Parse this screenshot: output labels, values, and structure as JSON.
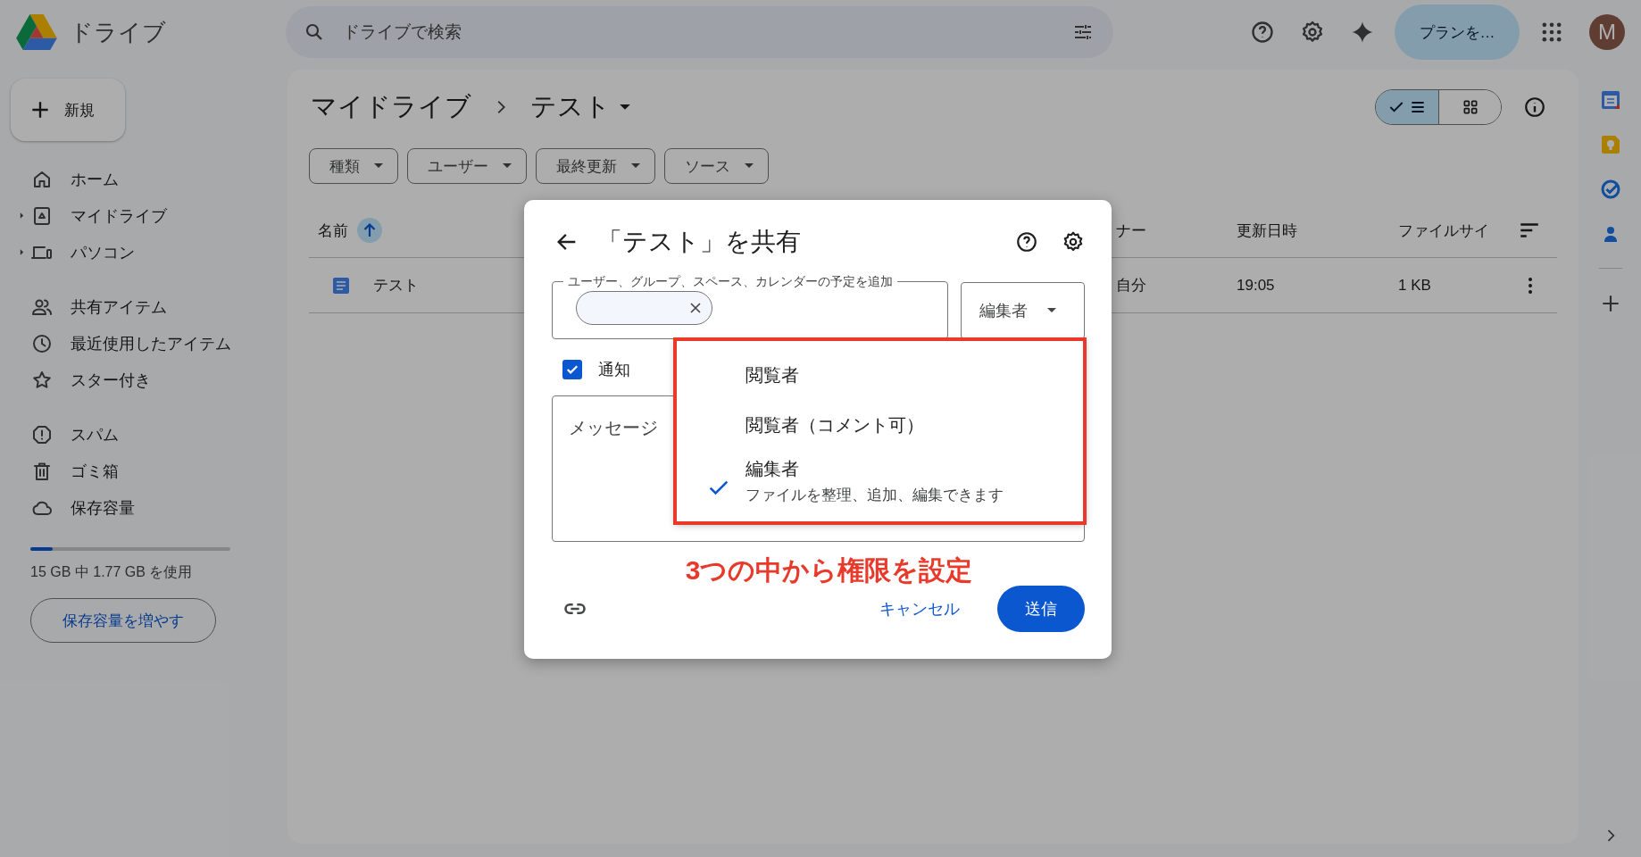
{
  "app": {
    "title": "ドライブ"
  },
  "search": {
    "placeholder": "ドライブで検索"
  },
  "header": {
    "plan_button": "プランを…",
    "avatar": "M"
  },
  "new_button": "新規",
  "sidebar": {
    "sections": [
      {
        "items": [
          {
            "label": "ホーム",
            "expandable": false
          },
          {
            "label": "マイドライブ",
            "expandable": true
          },
          {
            "label": "パソコン",
            "expandable": true
          }
        ]
      },
      {
        "items": [
          {
            "label": "共有アイテム",
            "expandable": false
          },
          {
            "label": "最近使用したアイテム",
            "expandable": false
          },
          {
            "label": "スター付き",
            "expandable": false
          }
        ]
      },
      {
        "items": [
          {
            "label": "スパム",
            "expandable": false
          },
          {
            "label": "ゴミ箱",
            "expandable": false
          },
          {
            "label": "保存容量",
            "expandable": false
          }
        ]
      }
    ]
  },
  "storage": {
    "level": 0.11,
    "text": "15 GB 中 1.77 GB を使用",
    "button": "保存容量を増やす"
  },
  "breadcrumb": [
    "マイドライブ",
    "テスト"
  ],
  "view_toggle": [
    {
      "kind": "list",
      "selected": true
    },
    {
      "kind": "grid",
      "selected": false
    }
  ],
  "filters": [
    "種類",
    "ユーザー",
    "最終更新",
    "ソース"
  ],
  "table": {
    "columns": [
      {
        "label": "名前",
        "sorted": true
      },
      {
        "label": "ナー"
      },
      {
        "label": "更新日時"
      },
      {
        "label": "ファイルサイ"
      }
    ],
    "rows": [
      {
        "name": "テスト",
        "owner": "自分",
        "modified": "19:05",
        "size": "1 KB"
      }
    ]
  },
  "dialog": {
    "title": "「テスト」を共有",
    "field_label": "ユーザー、グループ、スペース、カレンダーの予定を追加",
    "role": "編集者",
    "notify": {
      "label": "通知",
      "checked": true
    },
    "message_placeholder": "メッセージ",
    "cancel": "キャンセル",
    "send": "送信",
    "role_menu": [
      {
        "label": "閲覧者",
        "selected": false
      },
      {
        "label": "閲覧者（コメント可）",
        "selected": false
      },
      {
        "label": "編集者",
        "description": "ファイルを整理、追加、編集できます",
        "selected": true
      }
    ]
  },
  "annotation": {
    "caption": "3つの中から権限を設定"
  }
}
